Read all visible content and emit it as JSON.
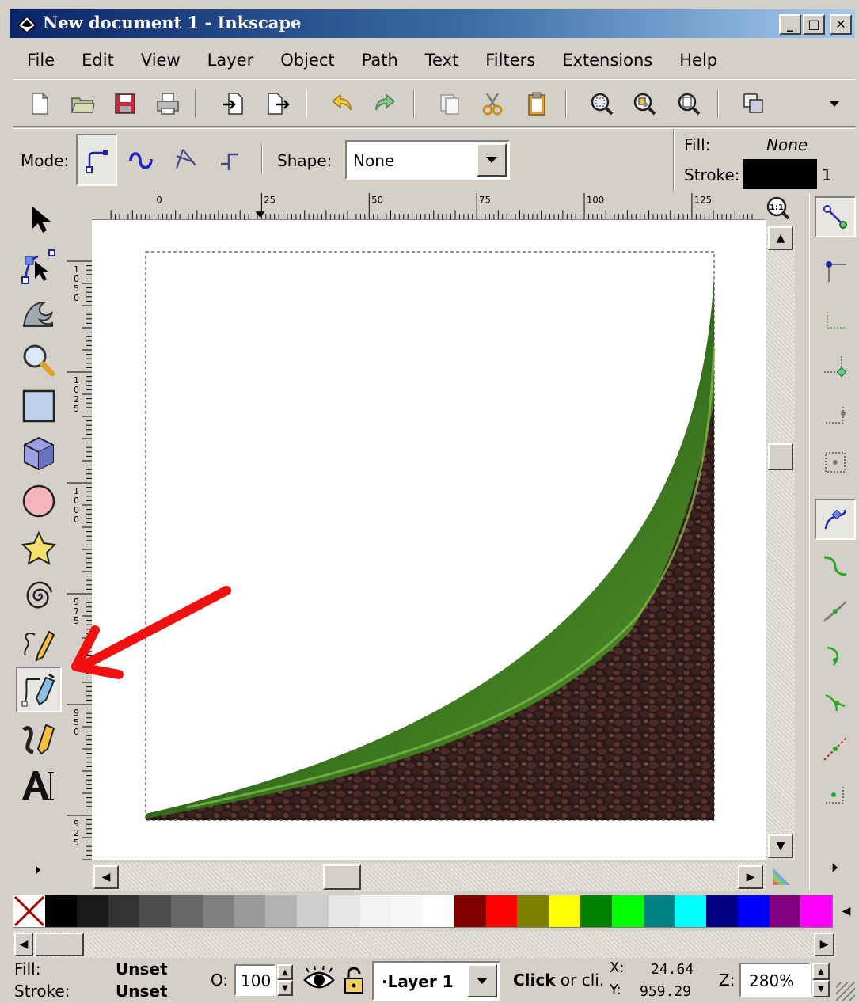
{
  "window": {
    "title": "New document 1 - Inkscape",
    "minimize": "_",
    "maximize": "□",
    "close": "✕"
  },
  "menu": [
    "File",
    "Edit",
    "View",
    "Layer",
    "Object",
    "Path",
    "Text",
    "Filters",
    "Extensions",
    "Help"
  ],
  "toolbar_icons": [
    "new-icon",
    "open-icon",
    "save-icon",
    "print-icon",
    "import-icon",
    "export-icon",
    "undo-icon",
    "redo-icon",
    "duplicate-icon",
    "cut-icon",
    "paste-icon",
    "zoom-selection-icon",
    "zoom-drawing-icon",
    "zoom-page-icon",
    "group-icon",
    "overflow-chevron-icon"
  ],
  "controls": {
    "mode_label": "Mode:",
    "shape_label": "Shape:",
    "shape_value": "None",
    "fill_label": "Fill:",
    "fill_value": "None",
    "stroke_label": "Stroke:",
    "stroke_width": "1"
  },
  "ruler": {
    "h_ticks": [
      "0",
      "25",
      "50",
      "75",
      "100",
      "125"
    ],
    "v_ticks": [
      "1050",
      "1025",
      "1000",
      "975",
      "950",
      "925"
    ],
    "zoom_one_to_one": "1:1"
  },
  "palette": [
    "#000000",
    "#1a1a1a",
    "#333333",
    "#4d4d4d",
    "#666666",
    "#808080",
    "#999999",
    "#b3b3b3",
    "#cccccc",
    "#e6e6e6",
    "#f2f2f2",
    "#f8f8f8",
    "#ffffff",
    "#800000",
    "#ff0000",
    "#808000",
    "#ffff00",
    "#008000",
    "#00ff00",
    "#008080",
    "#00ffff",
    "#000080",
    "#0000ff",
    "#800080",
    "#ff00ff"
  ],
  "status": {
    "fill_label": "Fill:",
    "fill_value": "Unset",
    "stroke_label": "Stroke:",
    "stroke_value": "Unset",
    "opacity_label": "O:",
    "opacity_value": "100",
    "layer": "·Layer 1",
    "message_bold": "Click",
    "message_rest": " or cli.",
    "x_label": "X:",
    "x_value": "24.64",
    "y_label": "Y:",
    "y_value": "959.29",
    "zoom_label": "Z:",
    "zoom_value": "280%"
  }
}
